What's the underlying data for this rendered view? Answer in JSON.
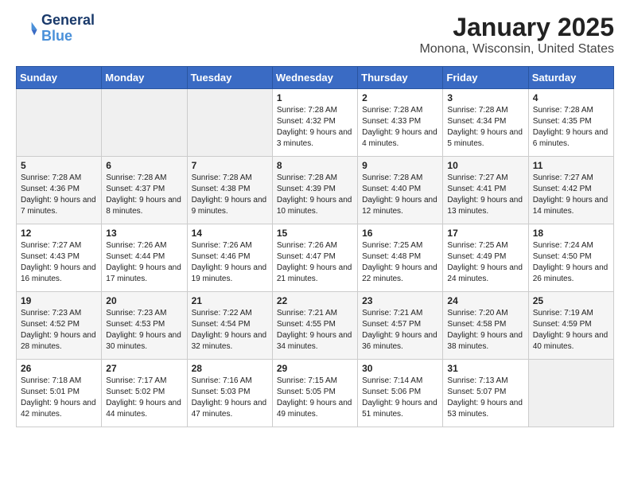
{
  "header": {
    "logo_line1": "General",
    "logo_line2": "Blue",
    "month_title": "January 2025",
    "location": "Monona, Wisconsin, United States"
  },
  "weekdays": [
    "Sunday",
    "Monday",
    "Tuesday",
    "Wednesday",
    "Thursday",
    "Friday",
    "Saturday"
  ],
  "weeks": [
    [
      {
        "day": "",
        "info": ""
      },
      {
        "day": "",
        "info": ""
      },
      {
        "day": "",
        "info": ""
      },
      {
        "day": "1",
        "info": "Sunrise: 7:28 AM\nSunset: 4:32 PM\nDaylight: 9 hours and 3 minutes."
      },
      {
        "day": "2",
        "info": "Sunrise: 7:28 AM\nSunset: 4:33 PM\nDaylight: 9 hours and 4 minutes."
      },
      {
        "day": "3",
        "info": "Sunrise: 7:28 AM\nSunset: 4:34 PM\nDaylight: 9 hours and 5 minutes."
      },
      {
        "day": "4",
        "info": "Sunrise: 7:28 AM\nSunset: 4:35 PM\nDaylight: 9 hours and 6 minutes."
      }
    ],
    [
      {
        "day": "5",
        "info": "Sunrise: 7:28 AM\nSunset: 4:36 PM\nDaylight: 9 hours and 7 minutes."
      },
      {
        "day": "6",
        "info": "Sunrise: 7:28 AM\nSunset: 4:37 PM\nDaylight: 9 hours and 8 minutes."
      },
      {
        "day": "7",
        "info": "Sunrise: 7:28 AM\nSunset: 4:38 PM\nDaylight: 9 hours and 9 minutes."
      },
      {
        "day": "8",
        "info": "Sunrise: 7:28 AM\nSunset: 4:39 PM\nDaylight: 9 hours and 10 minutes."
      },
      {
        "day": "9",
        "info": "Sunrise: 7:28 AM\nSunset: 4:40 PM\nDaylight: 9 hours and 12 minutes."
      },
      {
        "day": "10",
        "info": "Sunrise: 7:27 AM\nSunset: 4:41 PM\nDaylight: 9 hours and 13 minutes."
      },
      {
        "day": "11",
        "info": "Sunrise: 7:27 AM\nSunset: 4:42 PM\nDaylight: 9 hours and 14 minutes."
      }
    ],
    [
      {
        "day": "12",
        "info": "Sunrise: 7:27 AM\nSunset: 4:43 PM\nDaylight: 9 hours and 16 minutes."
      },
      {
        "day": "13",
        "info": "Sunrise: 7:26 AM\nSunset: 4:44 PM\nDaylight: 9 hours and 17 minutes."
      },
      {
        "day": "14",
        "info": "Sunrise: 7:26 AM\nSunset: 4:46 PM\nDaylight: 9 hours and 19 minutes."
      },
      {
        "day": "15",
        "info": "Sunrise: 7:26 AM\nSunset: 4:47 PM\nDaylight: 9 hours and 21 minutes."
      },
      {
        "day": "16",
        "info": "Sunrise: 7:25 AM\nSunset: 4:48 PM\nDaylight: 9 hours and 22 minutes."
      },
      {
        "day": "17",
        "info": "Sunrise: 7:25 AM\nSunset: 4:49 PM\nDaylight: 9 hours and 24 minutes."
      },
      {
        "day": "18",
        "info": "Sunrise: 7:24 AM\nSunset: 4:50 PM\nDaylight: 9 hours and 26 minutes."
      }
    ],
    [
      {
        "day": "19",
        "info": "Sunrise: 7:23 AM\nSunset: 4:52 PM\nDaylight: 9 hours and 28 minutes."
      },
      {
        "day": "20",
        "info": "Sunrise: 7:23 AM\nSunset: 4:53 PM\nDaylight: 9 hours and 30 minutes."
      },
      {
        "day": "21",
        "info": "Sunrise: 7:22 AM\nSunset: 4:54 PM\nDaylight: 9 hours and 32 minutes."
      },
      {
        "day": "22",
        "info": "Sunrise: 7:21 AM\nSunset: 4:55 PM\nDaylight: 9 hours and 34 minutes."
      },
      {
        "day": "23",
        "info": "Sunrise: 7:21 AM\nSunset: 4:57 PM\nDaylight: 9 hours and 36 minutes."
      },
      {
        "day": "24",
        "info": "Sunrise: 7:20 AM\nSunset: 4:58 PM\nDaylight: 9 hours and 38 minutes."
      },
      {
        "day": "25",
        "info": "Sunrise: 7:19 AM\nSunset: 4:59 PM\nDaylight: 9 hours and 40 minutes."
      }
    ],
    [
      {
        "day": "26",
        "info": "Sunrise: 7:18 AM\nSunset: 5:01 PM\nDaylight: 9 hours and 42 minutes."
      },
      {
        "day": "27",
        "info": "Sunrise: 7:17 AM\nSunset: 5:02 PM\nDaylight: 9 hours and 44 minutes."
      },
      {
        "day": "28",
        "info": "Sunrise: 7:16 AM\nSunset: 5:03 PM\nDaylight: 9 hours and 47 minutes."
      },
      {
        "day": "29",
        "info": "Sunrise: 7:15 AM\nSunset: 5:05 PM\nDaylight: 9 hours and 49 minutes."
      },
      {
        "day": "30",
        "info": "Sunrise: 7:14 AM\nSunset: 5:06 PM\nDaylight: 9 hours and 51 minutes."
      },
      {
        "day": "31",
        "info": "Sunrise: 7:13 AM\nSunset: 5:07 PM\nDaylight: 9 hours and 53 minutes."
      },
      {
        "day": "",
        "info": ""
      }
    ]
  ]
}
